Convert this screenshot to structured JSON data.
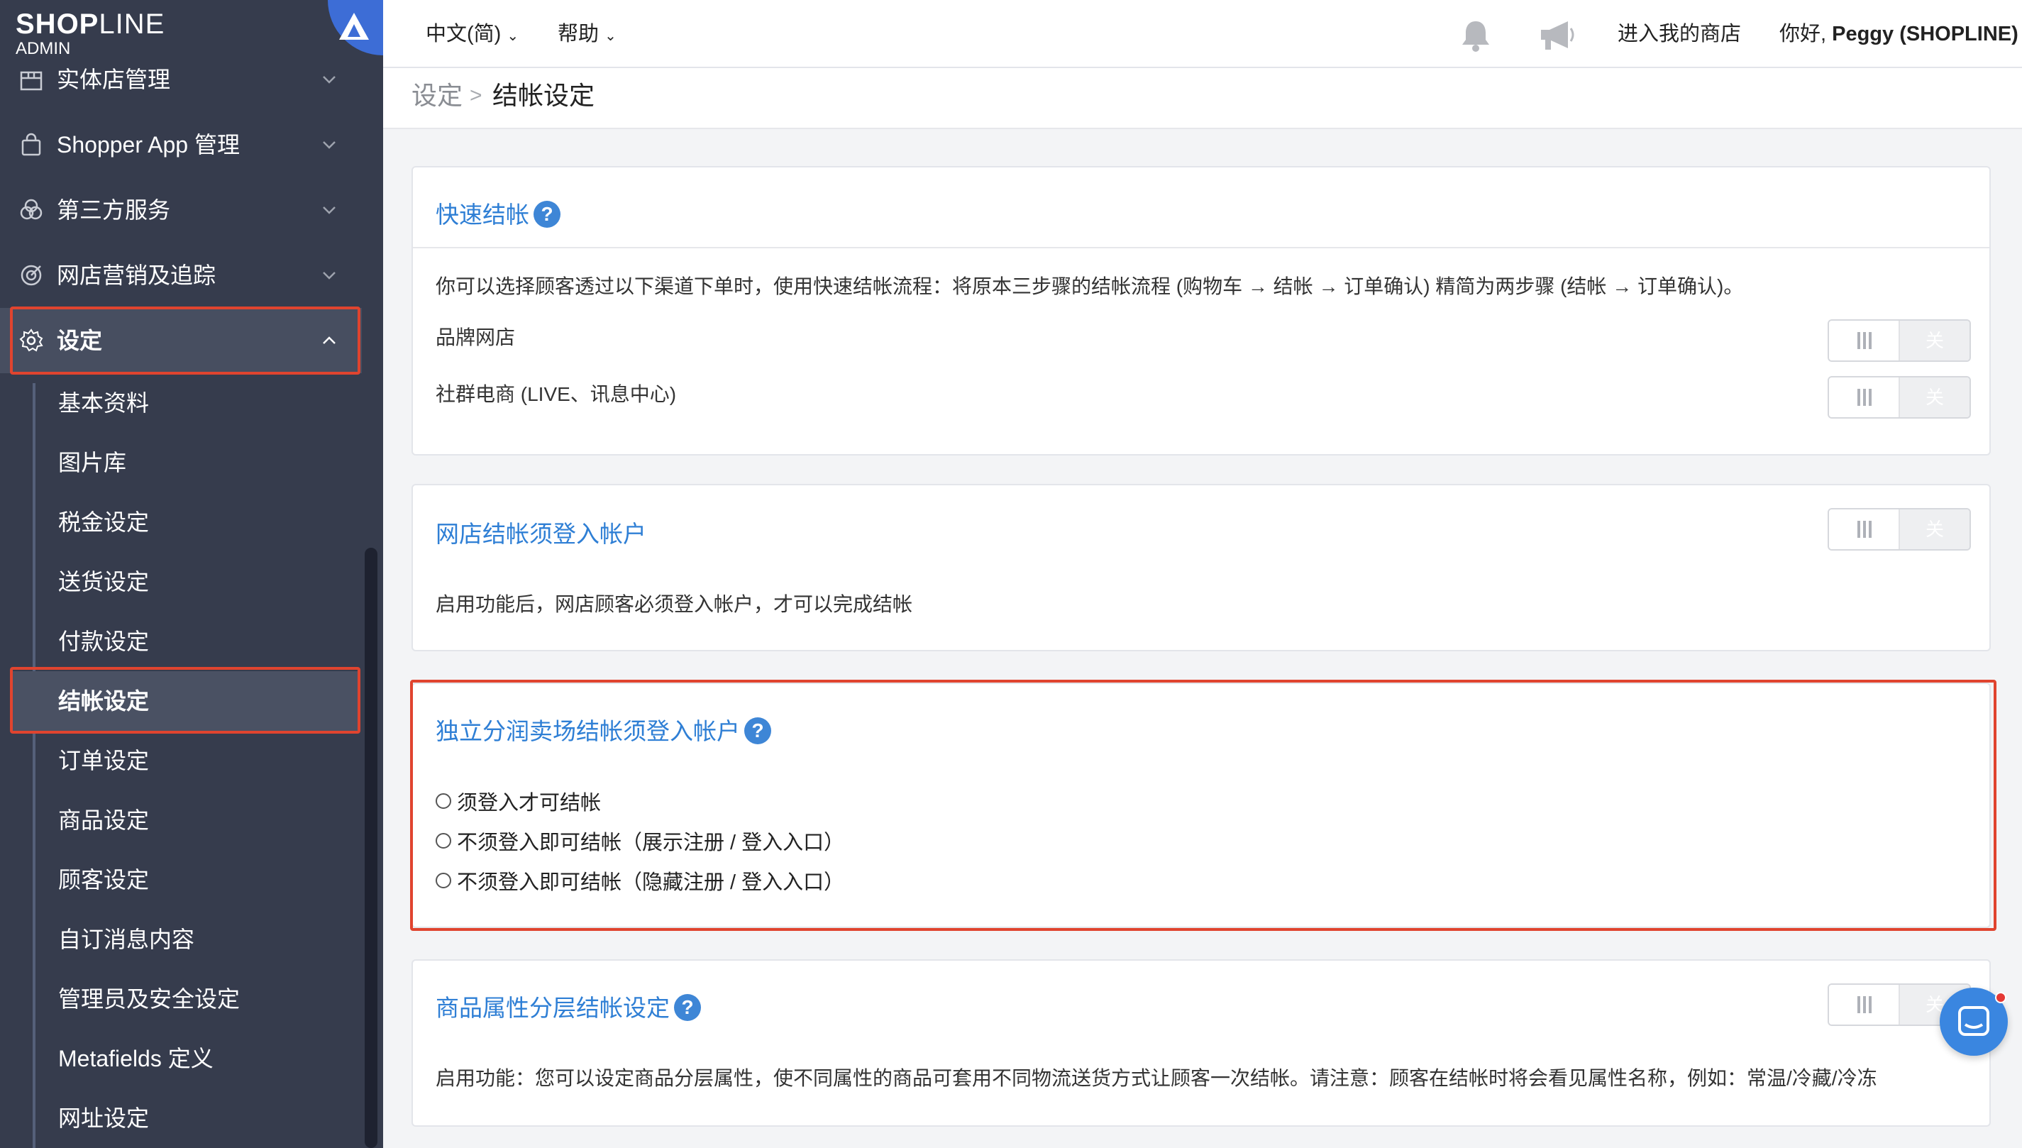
{
  "logo": {
    "brand_bold": "SHOP",
    "brand_thin": "LINE",
    "sub": "ADMIN"
  },
  "sidebar": {
    "items": [
      {
        "label": "实体店管理",
        "icon": "store-icon"
      },
      {
        "label": "Shopper App 管理",
        "icon": "shopping-bag-icon"
      },
      {
        "label": "第三方服务",
        "icon": "circles-icon"
      },
      {
        "label": "网店营销及追踪",
        "icon": "target-icon"
      },
      {
        "label": "设定",
        "icon": "gear-icon",
        "expanded": true
      }
    ],
    "sub_items": [
      {
        "label": "基本资料"
      },
      {
        "label": "图片库"
      },
      {
        "label": "税金设定"
      },
      {
        "label": "送货设定"
      },
      {
        "label": "付款设定"
      },
      {
        "label": "结帐设定",
        "active": true
      },
      {
        "label": "订单设定"
      },
      {
        "label": "商品设定"
      },
      {
        "label": "顾客设定"
      },
      {
        "label": "自订消息内容"
      },
      {
        "label": "管理员及安全设定"
      },
      {
        "label": "Metafields 定义"
      },
      {
        "label": "网址设定"
      }
    ]
  },
  "topbar": {
    "language": "中文(简)",
    "help": "帮助",
    "enter_store": "进入我的商店",
    "greeting_prefix": "你好,",
    "user_name": "Peggy (SHOPLINE)"
  },
  "breadcrumb": {
    "parent": "设定",
    "separator": ">",
    "current": "结帐设定"
  },
  "cards": {
    "fast_checkout": {
      "title": "快速结帐",
      "description": "你可以选择顾客透过以下渠道下单时，使用快速结帐流程：将原本三步骤的结帐流程 (购物车 → 结帐 → 订单确认) 精简为两步骤 (结帐 → 订单确认)。",
      "rows": [
        {
          "label": "品牌网店",
          "state": "关"
        },
        {
          "label": "社群电商 (LIVE、讯息中心)",
          "state": "关"
        }
      ]
    },
    "login_required": {
      "title": "网店结帐须登入帐户",
      "state": "关",
      "description": "启用功能后，网店顾客必须登入帐户，才可以完成结帐"
    },
    "affiliate": {
      "title": "独立分润卖场结帐须登入帐户",
      "options": [
        "须登入才可结帐",
        "不须登入即可结帐（展示注册 / 登入入口）",
        "不须登入即可结帐（隐藏注册 / 登入入口）"
      ]
    },
    "product_attr": {
      "title": "商品属性分层结帐设定",
      "state": "关",
      "description": "启用功能：您可以设定商品分层属性，使不同属性的商品可套用不同物流送货方式让顾客一次结帐。请注意：顾客在结帐时将会看见属性名称，例如：常温/冷藏/冷冻"
    }
  },
  "colors": {
    "sidebar_bg": "#363c4d",
    "accent": "#2f7fd5",
    "highlight": "#e0442f"
  }
}
